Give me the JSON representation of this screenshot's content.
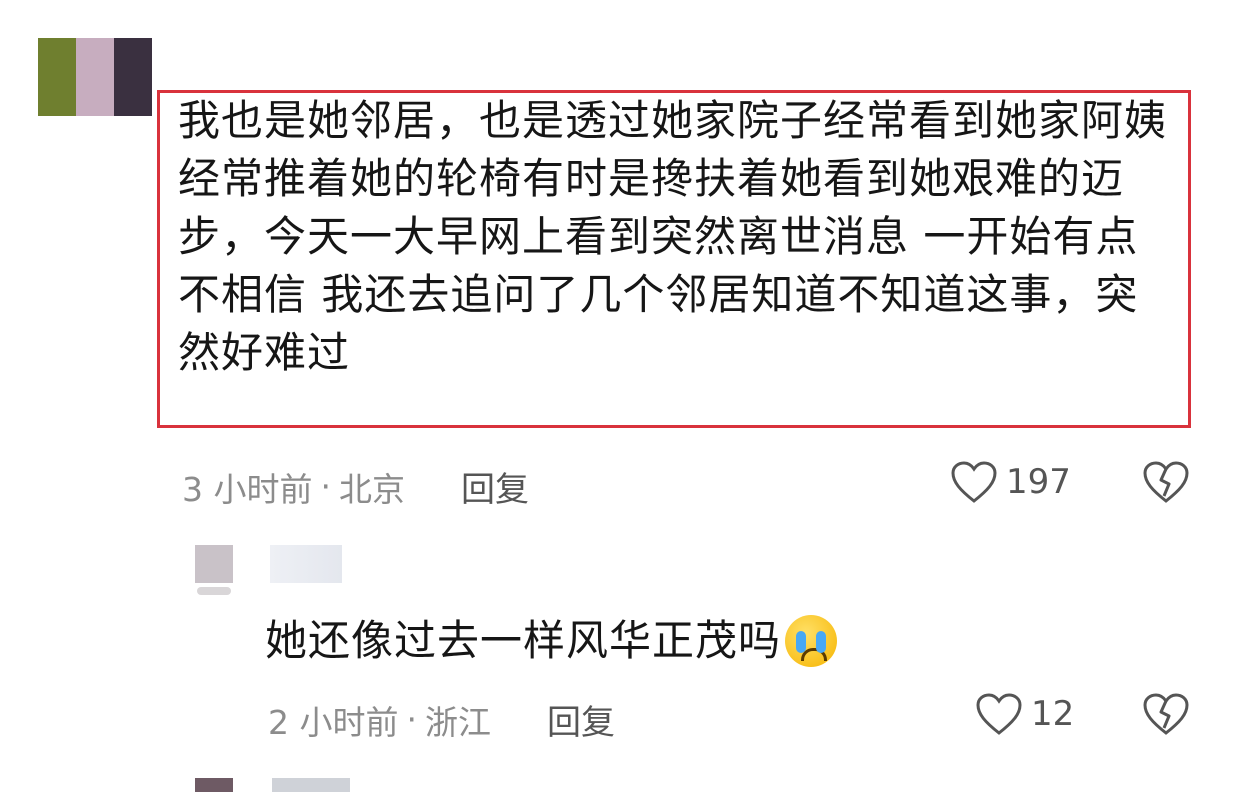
{
  "comment": {
    "avatar_colors": [
      "#6f7f2f",
      "#c7adbf",
      "#3a3040"
    ],
    "text": "我也是她邻居，也是透过她家院子经常看到她家阿姨经常推着她的轮椅有时是搀扶着她看到她艰难的迈步，今天一大早网上看到突然离世消息 一开始有点不相信 我还去追问了几个邻居知道不知道这事，突然好难过",
    "time": "3 小时前",
    "separator": "·",
    "location": "北京",
    "reply_label": "回复",
    "likes": "197",
    "highlight_color": "#d9323c"
  },
  "reply": {
    "text": "她还像过去一样风华正茂吗",
    "emoji": "crying-face-icon",
    "time": "2 小时前",
    "separator": "·",
    "location": "浙江",
    "reply_label": "回复",
    "likes": "12"
  }
}
